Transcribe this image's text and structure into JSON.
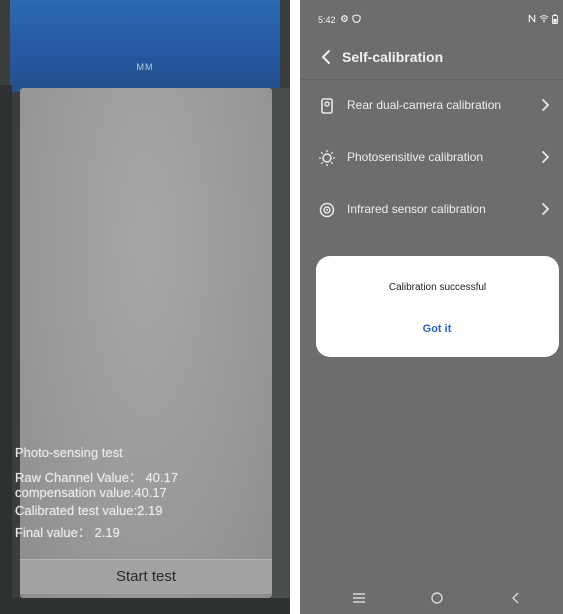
{
  "photo": {
    "tape_text": "MM",
    "test_title": "Photo-sensing test",
    "raw_channel": "Raw Channel Value： 40.17",
    "compensation": "compensation value:40.17",
    "calibrated": "Calibrated test value:2.19",
    "final_value": "Final value： 2.19",
    "start_button": "Start test"
  },
  "status_bar": {
    "time": "5:42",
    "left_icons": [
      "gear-icon",
      "shield-icon"
    ],
    "right_icons": [
      "nfc-icon",
      "wifi-icon",
      "battery-icon"
    ]
  },
  "header": {
    "title": "Self-calibration"
  },
  "settings": [
    {
      "label": "Rear dual-camera calibration",
      "icon": "camera-icon"
    },
    {
      "label": "Photosensitive calibration",
      "icon": "sun-icon"
    },
    {
      "label": "Infrared sensor calibration",
      "icon": "infrared-icon"
    }
  ],
  "dialog": {
    "message": "Calibration successful",
    "button": "Got it"
  },
  "navbar": {
    "icons": [
      "menu-icon",
      "home-icon",
      "back-icon"
    ]
  },
  "colors": {
    "phone_bg": "#6d6d6d",
    "dialog_bg": "#ffffff",
    "accent": "#2f63c6",
    "tape_blue": "#2a63a8"
  }
}
